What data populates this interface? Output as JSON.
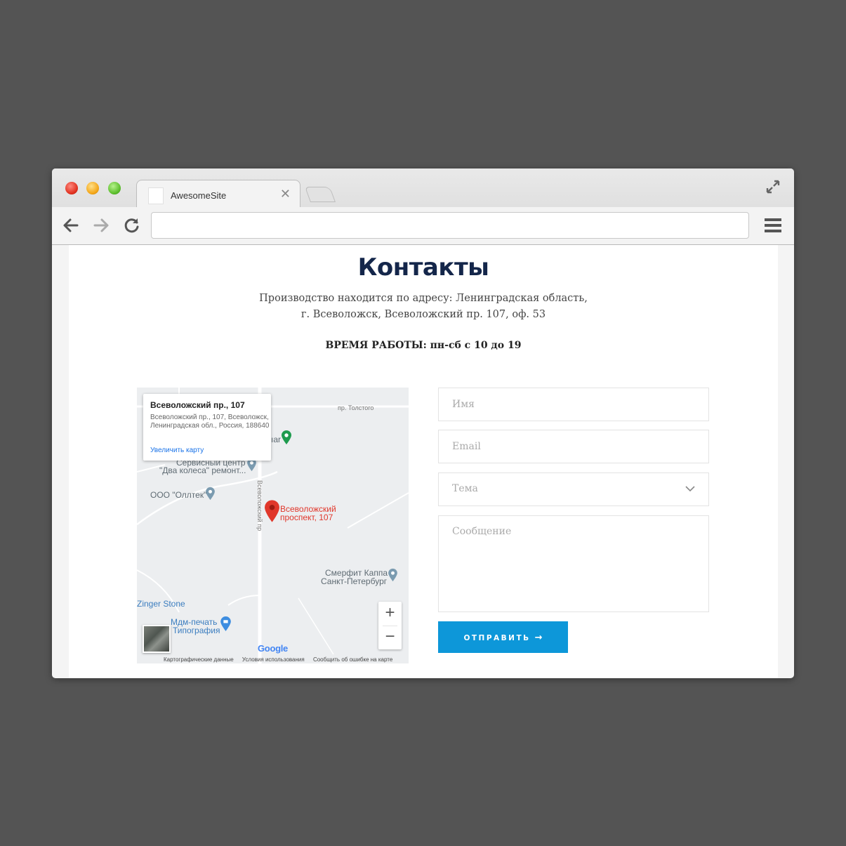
{
  "browser": {
    "tab_title": "AwesomeSite",
    "tab_close": "✕",
    "address_value": "",
    "address_placeholder": ""
  },
  "page": {
    "heading": "Контакты",
    "address_line1": "Производство находится по адресу: Ленинградская область,",
    "address_line2": "г. Всеволожск, Всеволожский пр. 107, оф. 53",
    "hours": "ВРЕМЯ РАБОТЫ: пн-сб с 10 до 19"
  },
  "map": {
    "info_title": "Всеволожский пр., 107",
    "info_address": "Всеволожский пр., 107, Всеволожск, Ленинградская обл., Россия, 188640",
    "info_link": "Увеличить карту",
    "labels": {
      "street_tolstogo": "пр. Толстого",
      "street_vsevolozhsky": "Всеволожский пр",
      "gar": "ıar",
      "service_center_1": "Сервисный центр",
      "service_center_2": "\"Два колеса\" ремонт...",
      "olltek": "ООО \"Оллтек\"",
      "marker_1": "Всеволожский",
      "marker_2": "проспект, 107",
      "smerfit_1": "Смерфит Каппа",
      "smerfit_2": "Санкт-Петербург",
      "zinger": "Zinger Stone",
      "mdm_1": "Мдм-печать",
      "mdm_2": "Типография"
    },
    "zoom_in": "+",
    "zoom_out": "−",
    "google": "Google",
    "footer": [
      "Картографические данные",
      "Условия использования",
      "Сообщить об ошибке на карте"
    ]
  },
  "form": {
    "name_placeholder": "Имя",
    "email_placeholder": "Email",
    "subject_value": "Тема",
    "message_placeholder": "Сообщение",
    "submit_label": "ОТПРАВИТЬ",
    "submit_arrow": "→"
  },
  "colors": {
    "heading": "#14264a",
    "accent": "#0d97d9",
    "marker": "#e0372b"
  }
}
